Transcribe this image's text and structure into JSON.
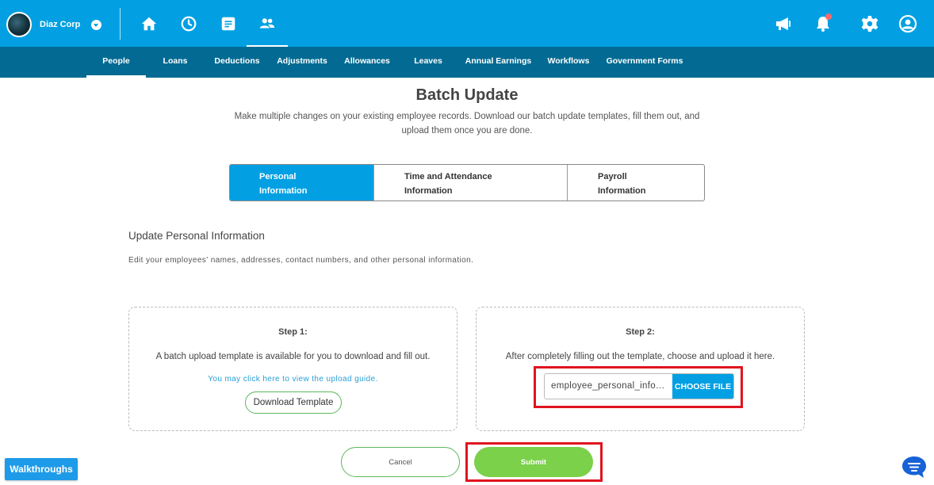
{
  "header": {
    "company_name": "Diaz Corp",
    "nav_icons": [
      "home-icon",
      "clock-icon",
      "document-icon",
      "people-icon"
    ],
    "active_icon": "people-icon",
    "right_icons": [
      "megaphone-icon",
      "bell-icon",
      "gear-icon",
      "user-icon"
    ],
    "accent_color": "#02a0e3",
    "notification_dot_color": "#ff6b6b"
  },
  "subnav": {
    "items": [
      {
        "label": "People"
      },
      {
        "label": "Loans"
      },
      {
        "label": "Deductions"
      },
      {
        "label": "Adjustments"
      },
      {
        "label": "Allowances"
      },
      {
        "label": "Leaves"
      },
      {
        "label": "Annual Earnings"
      },
      {
        "label": "Workflows"
      },
      {
        "label": "Government Forms"
      }
    ],
    "active": "People",
    "background_color": "#036b93"
  },
  "page": {
    "title": "Batch Update",
    "subtitle": "Make multiple changes on your existing employee records. Download our batch update templates, fill them out, and upload them once you are done."
  },
  "tabs": [
    {
      "label": "Personal Information",
      "active": true
    },
    {
      "label": "Time and Attendance Information",
      "active": false
    },
    {
      "label": "Payroll Information",
      "active": false
    }
  ],
  "section": {
    "title": "Update Personal Information",
    "description": "Edit your employees' names, addresses, contact numbers, and other personal information."
  },
  "step1": {
    "heading": "Step 1:",
    "text": "A batch upload template is available for you to download and fill out.",
    "link": "You may click here to view the upload guide.",
    "button": "Download Template"
  },
  "step2": {
    "heading": "Step 2:",
    "text": "After completely filling out the template, choose and upload it here.",
    "file_value": "employee_personal_information_template.xlsx",
    "choose_button": "CHOOSE FILE"
  },
  "actions": {
    "cancel": "Cancel",
    "submit": "Submit",
    "submit_color": "#7bd14a",
    "highlight_color": "#e0141e"
  },
  "walkthroughs": "Walkthroughs"
}
